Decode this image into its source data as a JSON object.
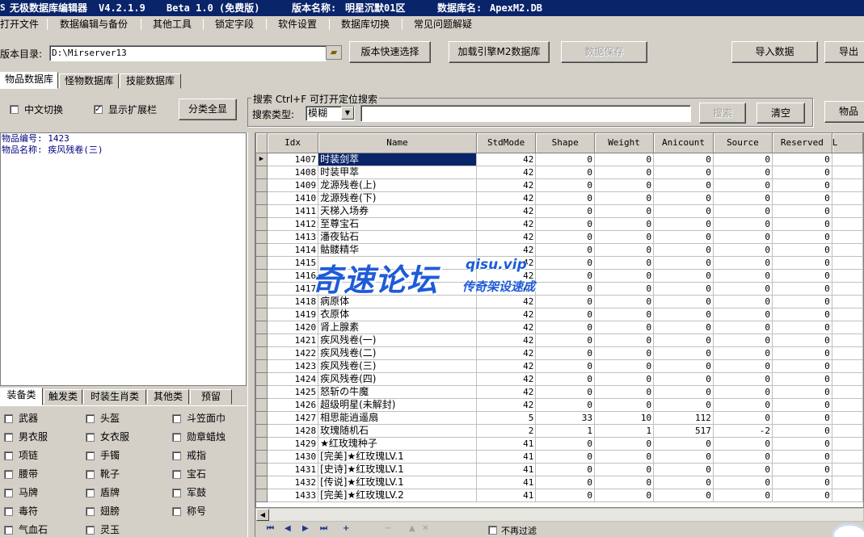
{
  "titlebar": {
    "app_name": "无极数据库编辑器",
    "version": "V4.2.1.9",
    "edition": "Beta 1.0 (免费版)",
    "version_name_label": "版本名称:",
    "version_name_value": "明星沉默01区",
    "db_name_label": "数据库名:",
    "db_name_value": "ApexM2.DB"
  },
  "menu": [
    "打开文件",
    "数据编辑与备份",
    "其他工具",
    "锁定字段",
    "软件设置",
    "数据库切换",
    "常见问题解疑"
  ],
  "toolbar": {
    "dir_label": "版本目录:",
    "dir_value": "D:\\Mirserver13",
    "quick_select": "版本快速选择",
    "load_engine": "加载引擎M2数据库",
    "save_data": "数据保存",
    "import_data": "导入数据",
    "export_data": "导出"
  },
  "db_tabs": [
    "物品数据库",
    "怪物数据库",
    "技能数据库"
  ],
  "options": {
    "chinese_toggle": "中文切换",
    "show_ext": "显示扩展栏",
    "show_ext_checked": "✓",
    "expand_all": "分类全显"
  },
  "search": {
    "group_label": "搜索  Ctrl+F 可打开定位搜索",
    "type_label": "搜索类型:",
    "type_value": "模糊",
    "query": "",
    "search_button": "搜索",
    "clear_button": "清空",
    "items_button": "物品"
  },
  "info": {
    "item_no": "物品编号: 1423",
    "item_name": "物品名称: 疾风残卷(三)"
  },
  "cat_tabs": [
    "装备类",
    "触发类",
    "时装生肖类",
    "其他类",
    "预留"
  ],
  "categories": [
    [
      "武器",
      "头盔",
      "斗笠面巾"
    ],
    [
      "男衣服",
      "女衣服",
      "勋章蜡烛"
    ],
    [
      "项链",
      "手镯",
      "戒指"
    ],
    [
      "腰带",
      "靴子",
      "宝石"
    ],
    [
      "马牌",
      "盾牌",
      "军鼓"
    ],
    [
      "毒符",
      "翅膀",
      "称号"
    ],
    [
      "气血石",
      "灵玉",
      ""
    ]
  ],
  "grid": {
    "columns": [
      "Idx",
      "Name",
      "StdMode",
      "Shape",
      "Weight",
      "Anicount",
      "Source",
      "Reserved",
      "L"
    ],
    "rows": [
      [
        "1407",
        "时装剑萃",
        "42",
        "0",
        "0",
        "0",
        "0",
        "0"
      ],
      [
        "1408",
        "时装甲萃",
        "42",
        "0",
        "0",
        "0",
        "0",
        "0"
      ],
      [
        "1409",
        "龙源残卷(上)",
        "42",
        "0",
        "0",
        "0",
        "0",
        "0"
      ],
      [
        "1410",
        "龙源残卷(下)",
        "42",
        "0",
        "0",
        "0",
        "0",
        "0"
      ],
      [
        "1411",
        "天梯入场券",
        "42",
        "0",
        "0",
        "0",
        "0",
        "0"
      ],
      [
        "1412",
        "至尊宝石",
        "42",
        "0",
        "0",
        "0",
        "0",
        "0"
      ],
      [
        "1413",
        "潘夜钻石",
        "42",
        "0",
        "0",
        "0",
        "0",
        "0"
      ],
      [
        "1414",
        "骷髅精华",
        "42",
        "0",
        "0",
        "0",
        "0",
        "0"
      ],
      [
        "1415",
        "",
        "42",
        "0",
        "0",
        "0",
        "0",
        "0"
      ],
      [
        "1416",
        "",
        "42",
        "0",
        "0",
        "0",
        "0",
        "0"
      ],
      [
        "1417",
        "",
        "42",
        "0",
        "0",
        "0",
        "0",
        "0"
      ],
      [
        "1418",
        "病原体",
        "42",
        "0",
        "0",
        "0",
        "0",
        "0"
      ],
      [
        "1419",
        "衣原体",
        "42",
        "0",
        "0",
        "0",
        "0",
        "0"
      ],
      [
        "1420",
        "肾上腺素",
        "42",
        "0",
        "0",
        "0",
        "0",
        "0"
      ],
      [
        "1421",
        "疾风残卷(一)",
        "42",
        "0",
        "0",
        "0",
        "0",
        "0"
      ],
      [
        "1422",
        "疾风残卷(二)",
        "42",
        "0",
        "0",
        "0",
        "0",
        "0"
      ],
      [
        "1423",
        "疾风残卷(三)",
        "42",
        "0",
        "0",
        "0",
        "0",
        "0"
      ],
      [
        "1424",
        "疾风残卷(四)",
        "42",
        "0",
        "0",
        "0",
        "0",
        "0"
      ],
      [
        "1425",
        "怒斩の牛魔",
        "42",
        "0",
        "0",
        "0",
        "0",
        "0"
      ],
      [
        "1426",
        "超级明星(未解封)",
        "42",
        "0",
        "0",
        "0",
        "0",
        "0"
      ],
      [
        "1427",
        "相思能逍遥扇",
        "5",
        "33",
        "10",
        "112",
        "0",
        "0"
      ],
      [
        "1428",
        "玫瑰随机石",
        "2",
        "1",
        "1",
        "517",
        "-2",
        "0"
      ],
      [
        "1429",
        "★红玫瑰种子",
        "41",
        "0",
        "0",
        "0",
        "0",
        "0"
      ],
      [
        "1430",
        "[完美]★红玫瑰LV.1",
        "41",
        "0",
        "0",
        "0",
        "0",
        "0"
      ],
      [
        "1431",
        "[史诗]★红玫瑰LV.1",
        "41",
        "0",
        "0",
        "0",
        "0",
        "0"
      ],
      [
        "1432",
        "[传说]★红玫瑰LV.1",
        "41",
        "0",
        "0",
        "0",
        "0",
        "0"
      ],
      [
        "1433",
        "[完美]★红玫瑰LV.2",
        "41",
        "0",
        "0",
        "0",
        "0",
        "0"
      ]
    ]
  },
  "nav_partial": "不再过滤",
  "watermark": {
    "main": "奇速论坛",
    "url": "qisu.vip",
    "slogan": "传奇架设速成"
  },
  "colors": {
    "titlebar": "#0a246a",
    "selection": "#0a246a",
    "info_text": "#000080",
    "watermark": "#1e5bd8"
  }
}
